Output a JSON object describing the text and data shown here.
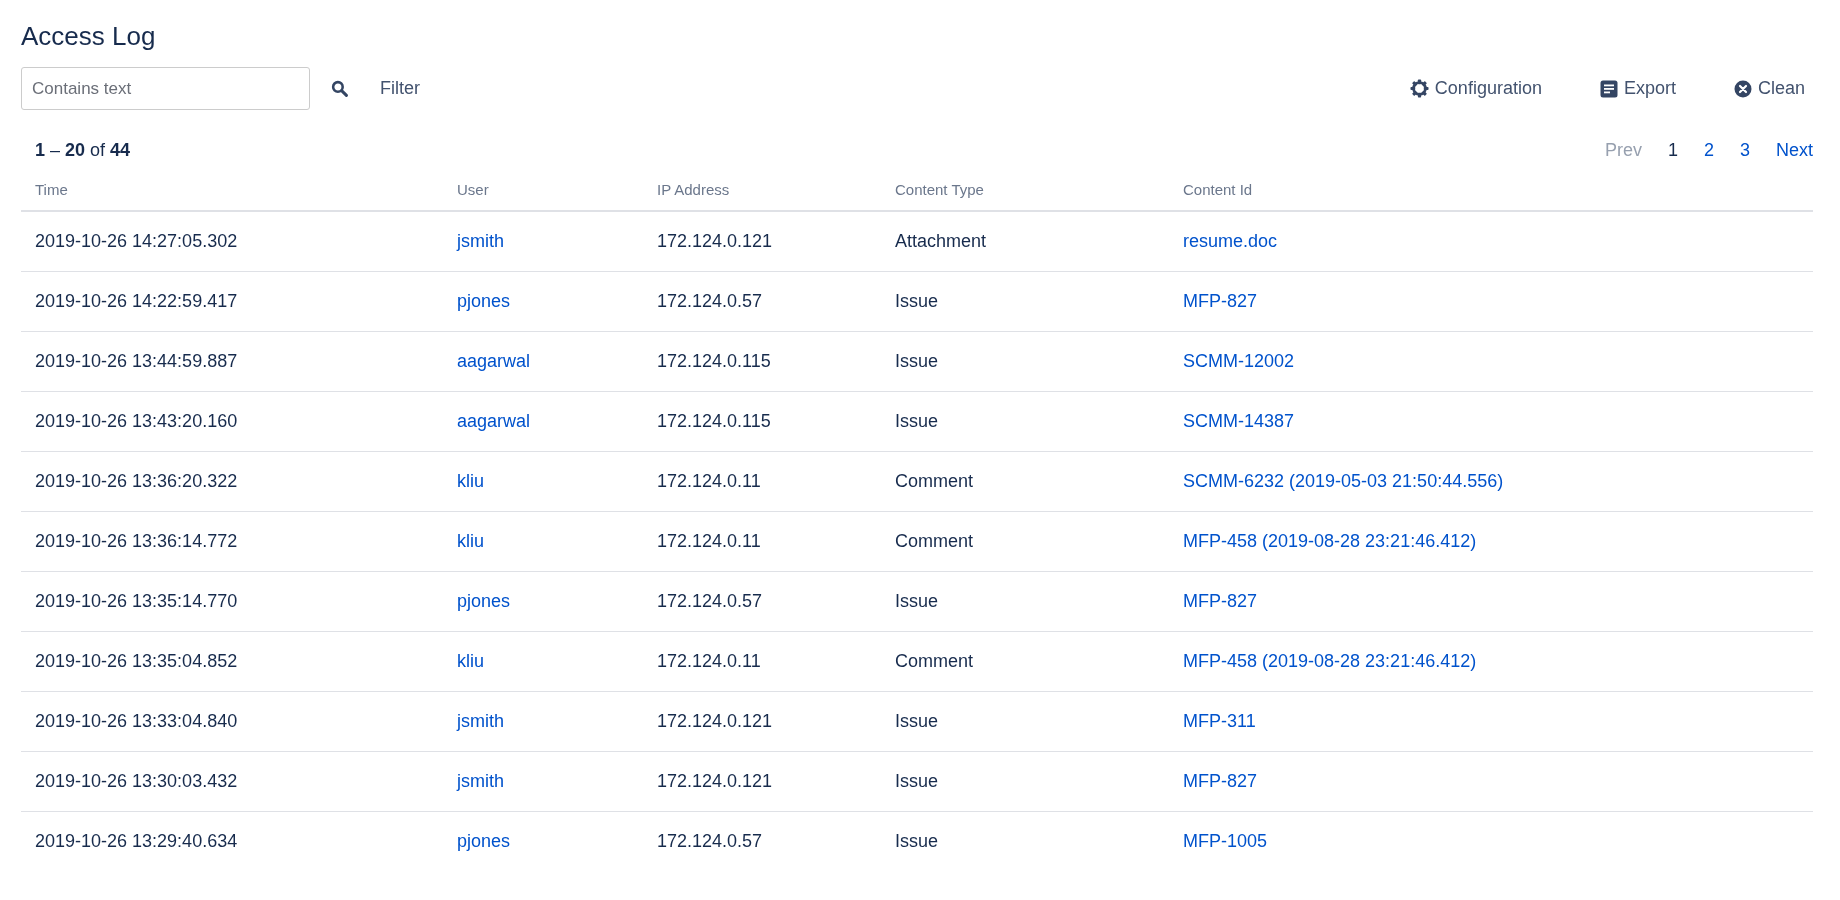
{
  "title": "Access Log",
  "search": {
    "placeholder": "Contains text"
  },
  "filter_label": "Filter",
  "actions": [
    {
      "kind": "gear",
      "label": "Configuration"
    },
    {
      "kind": "export",
      "label": "Export"
    },
    {
      "kind": "clean",
      "label": "Clean"
    }
  ],
  "range": "**1** – **20** of **44**",
  "pagination": {
    "prev": {
      "label": "Prev",
      "disabled": true
    },
    "pages": [
      {
        "label": "1",
        "selected": true
      },
      {
        "label": "2",
        "selected": false
      },
      {
        "label": "3",
        "selected": false
      }
    ],
    "next": {
      "label": "Next",
      "disabled": false
    }
  },
  "table": {
    "columns": [
      "Time",
      "User",
      "IP Address",
      "Content Type",
      "Content Id"
    ],
    "rows": [
      {
        "time": "2019-10-26 14:27:05.302",
        "user": "jsmith",
        "ip": "172.124.0.121",
        "type": "Attachment",
        "content": "resume.doc"
      },
      {
        "time": "2019-10-26 14:22:59.417",
        "user": "pjones",
        "ip": "172.124.0.57",
        "type": "Issue",
        "content": "MFP-827"
      },
      {
        "time": "2019-10-26 13:44:59.887",
        "user": "aagarwal",
        "ip": "172.124.0.115",
        "type": "Issue",
        "content": "SCMM-12002"
      },
      {
        "time": "2019-10-26 13:43:20.160",
        "user": "aagarwal",
        "ip": "172.124.0.115",
        "type": "Issue",
        "content": "SCMM-14387"
      },
      {
        "time": "2019-10-26 13:36:20.322",
        "user": "kliu",
        "ip": "172.124.0.11",
        "type": "Comment",
        "content": "SCMM-6232 (2019-05-03 21:50:44.556)"
      },
      {
        "time": "2019-10-26 13:36:14.772",
        "user": "kliu",
        "ip": "172.124.0.11",
        "type": "Comment",
        "content": "MFP-458 (2019-08-28 23:21:46.412)"
      },
      {
        "time": "2019-10-26 13:35:14.770",
        "user": "pjones",
        "ip": "172.124.0.57",
        "type": "Issue",
        "content": "MFP-827"
      },
      {
        "time": "2019-10-26 13:35:04.852",
        "user": "kliu",
        "ip": "172.124.0.11",
        "type": "Comment",
        "content": "MFP-458 (2019-08-28 23:21:46.412)"
      },
      {
        "time": "2019-10-26 13:33:04.840",
        "user": "jsmith",
        "ip": "172.124.0.121",
        "type": "Issue",
        "content": "MFP-311"
      },
      {
        "time": "2019-10-26 13:30:03.432",
        "user": "jsmith",
        "ip": "172.124.0.121",
        "type": "Issue",
        "content": "MFP-827"
      },
      {
        "time": "2019-10-26 13:29:40.634",
        "user": "pjones",
        "ip": "172.124.0.57",
        "type": "Issue",
        "content": "MFP-1005"
      }
    ]
  }
}
